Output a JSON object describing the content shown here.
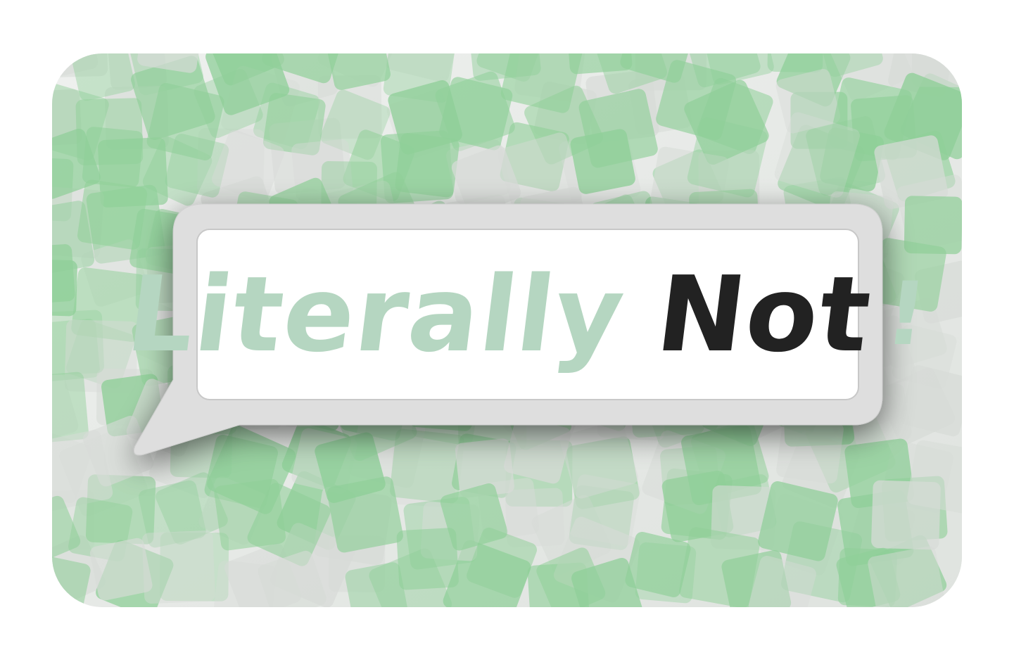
{
  "logo": {
    "word_1": "Literally",
    "word_2": "Not",
    "punctuation": "!"
  },
  "colors": {
    "tile_green": "#8fcf98",
    "tile_gray": "#d7dbd7",
    "background": "#e6e8e6",
    "bubble_frame": "#dedede",
    "bubble_panel": "#ffffff",
    "text_light": "#b5d6c1",
    "text_dark": "#222222"
  }
}
